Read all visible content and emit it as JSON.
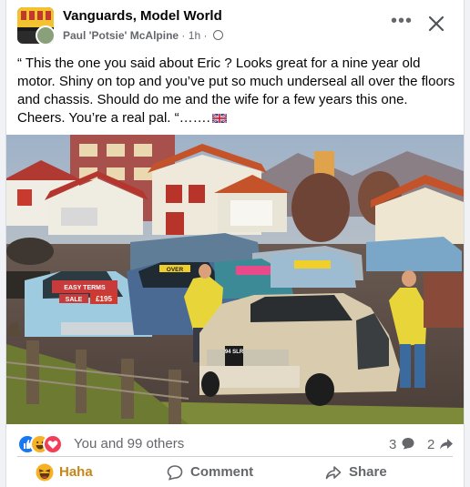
{
  "post": {
    "page_name": "Vanguards, Model World",
    "author": "Paul 'Potsie' McAlpine",
    "time": "1h",
    "separator": "·",
    "text": "“ This the one you said about Eric ? Looks great for a nine year old motor. Shiny on top and you’ve put so much underseal all over the floors and chassis. Should do me and the wife for a few years this one. Cheers. You’re a real pal. “…….",
    "more_label": "•••",
    "photo_texts": {
      "sign_blue": "EASY TERMS",
      "sign_red": "SALE",
      "price": "£195",
      "sign_yellow_1": "OVER",
      "plate": "94 SLR"
    }
  },
  "reactions": {
    "summary": "You and 99 others",
    "comments": "3",
    "shares": "2"
  },
  "actions": {
    "haha": "Haha",
    "comment": "Comment",
    "share": "Share"
  },
  "colors": {
    "accent_haha": "#c8861a",
    "like_blue": "#1877f2",
    "love_red": "#f33e58",
    "muted": "#65676b"
  }
}
